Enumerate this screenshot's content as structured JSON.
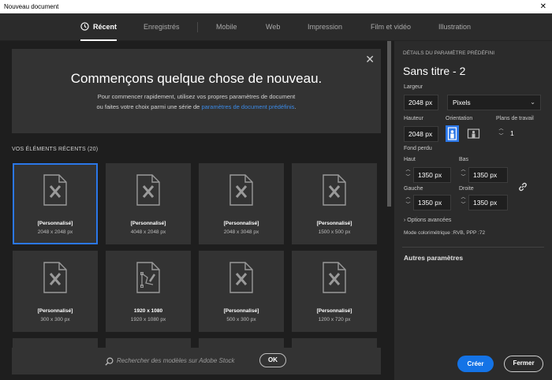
{
  "window": {
    "title": "Nouveau document",
    "close_glyph": "✕"
  },
  "tabs": [
    {
      "label": "Récent",
      "active": true
    },
    {
      "label": "Enregistrés"
    },
    {
      "label": "Mobile"
    },
    {
      "label": "Web"
    },
    {
      "label": "Impression"
    },
    {
      "label": "Film et vidéo"
    },
    {
      "label": "Illustration"
    }
  ],
  "welcome": {
    "close_glyph": "✕",
    "title": "Commençons quelque chose de nouveau.",
    "line1": "Pour commencer rapidement, utilisez vos propres paramètres de document",
    "line2_prefix": "ou faites votre choix parmi une série de ",
    "line2_link": "paramètres de document prédéfinis",
    "line2_suffix": "."
  },
  "recent": {
    "heading": "VOS ÉLÉMENTS RÉCENTS  (20)",
    "items": [
      {
        "name": "[Personnalisé]",
        "size": "2048 x 2048 px",
        "icon": "custom-doc-icon"
      },
      {
        "name": "[Personnalisé]",
        "size": "4048 x 2048 px",
        "icon": "custom-doc-icon"
      },
      {
        "name": "[Personnalisé]",
        "size": "2048 x 3048 px",
        "icon": "custom-doc-icon"
      },
      {
        "name": "[Personnalisé]",
        "size": "1500 x 500 px",
        "icon": "custom-doc-icon"
      },
      {
        "name": "[Personnalisé]",
        "size": "300 x 300 px",
        "icon": "custom-doc-icon"
      },
      {
        "name": "1920 x 1080",
        "size": "1920 x 1080 px",
        "icon": "illustration-doc-icon"
      },
      {
        "name": "[Personnalisé]",
        "size": "500 x 300 px",
        "icon": "custom-doc-icon"
      },
      {
        "name": "[Personnalisé]",
        "size": "1200 x 720 px",
        "icon": "custom-doc-icon"
      }
    ]
  },
  "search": {
    "placeholder": "Rechercher des modèles sur Adobe Stock",
    "ok_label": "OK"
  },
  "details": {
    "heading": "DÉTAILS DU PARAMÈTRE PRÉDÉFINI",
    "doc_name": "Sans titre - 2",
    "width_label": "Largeur",
    "width_value": "2048 px",
    "unit_value": "Pixels",
    "height_label": "Hauteur",
    "height_value": "2048 px",
    "orientation_label": "Orientation",
    "artboards_label": "Plans de travail",
    "artboards_value": "1",
    "bleed_label": "Fond perdu",
    "top_label": "Haut",
    "top_value": "1350 px",
    "bottom_label": "Bas",
    "bottom_value": "1350 px",
    "left_label": "Gauche",
    "left_value": "1350 px",
    "right_label": "Droite",
    "right_value": "1350 px",
    "advanced_label": "Options avancées",
    "mode_text": "Mode colorimétrique :RVB, PPP :72",
    "more_label": "Autres paramètres",
    "create_label": "Créer",
    "close_label": "Fermer"
  }
}
